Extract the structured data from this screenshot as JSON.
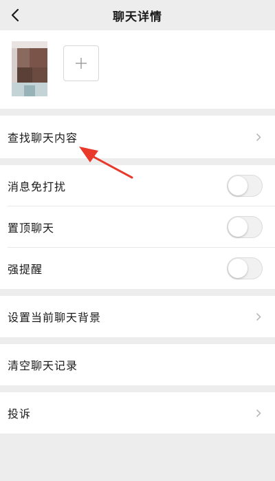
{
  "navbar": {
    "title": "聊天详情",
    "back_icon": "chevron-left-icon"
  },
  "members": {
    "add_icon": "plus-icon"
  },
  "rows": {
    "search_chat": "查找聊天内容",
    "mute": "消息免打扰",
    "sticky": "置顶聊天",
    "strong_alert": "强提醒",
    "set_background": "设置当前聊天背景",
    "clear_history": "清空聊天记录",
    "report": "投诉"
  },
  "toggles": {
    "mute_on": false,
    "sticky_on": false,
    "strong_alert_on": false
  },
  "colors": {
    "background": "#ededed",
    "annotation_arrow": "#e8392b"
  }
}
